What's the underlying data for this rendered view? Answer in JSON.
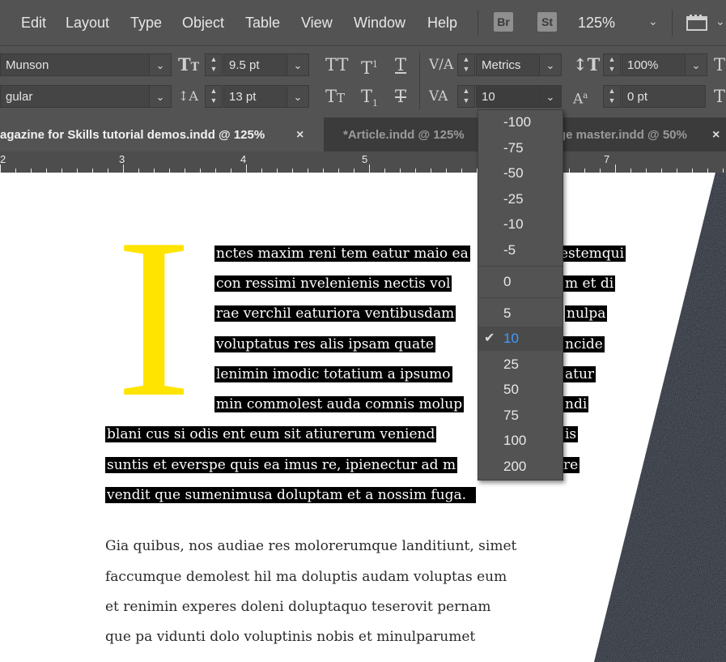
{
  "menu": {
    "items": [
      "Edit",
      "Layout",
      "Type",
      "Object",
      "Table",
      "View",
      "Window",
      "Help"
    ],
    "bridge_label": "Br",
    "stock_label": "St",
    "zoom": "125%"
  },
  "control_panel": {
    "font_family": "Munson",
    "font_style": "gular",
    "font_size": "9.5 pt",
    "leading": "13 pt",
    "kerning": "Metrics",
    "tracking": "10",
    "vertical_scale": "100%",
    "baseline_shift": "0 pt"
  },
  "tabs": [
    {
      "label": "agazine for Skills tutorial demos.indd @ 125%",
      "active": true,
      "close": "×"
    },
    {
      "label": "*Article.indd @ 125%",
      "active": false
    },
    {
      "label": "ge master.indd @ 50%",
      "active": false,
      "close": "×"
    }
  ],
  "ruler": {
    "labels": [
      "2",
      "3",
      "4",
      "5",
      "7"
    ]
  },
  "document": {
    "drop_cap": "I",
    "drop_cap_color": "#ffe400",
    "selected_lines": [
      "nctes maxim reni tem eatur maio ea",
      "estemqui",
      "con ressimi nvelenienis nectis vol",
      "m et di",
      "rae verchil eaturiora ventibusdam",
      "nulpa",
      "voluptatus res alis ipsam quate",
      "ncide",
      "lenimin imodic totatium a ipsumo",
      "atur",
      "min commolest auda comnis molup",
      "ndi",
      "blani cus si odis ent eum sit atiurerum veniend",
      "is",
      "suntis et everspe quis ea imus re, ipienectur ad m",
      "re",
      "vendit que sumenimusa doluptam et a nossim fuga."
    ],
    "body_lines": [
      "Gia quibus, nos audiae res molorerumque landitiunt, simet",
      "faccumque demolest hil ma doluptis audam voluptas eum",
      "et renimin experes doleni doluptaquo teserovit pernam",
      "que pa vidunti dolo voluptinis nobis et minulparumet"
    ]
  },
  "tracking_dropdown": {
    "options": [
      "-100",
      "-75",
      "-50",
      "-25",
      "-10",
      "-5",
      "0",
      "5",
      "10",
      "25",
      "50",
      "75",
      "100",
      "200"
    ],
    "selected": "10",
    "accent_color": "#3e9bff"
  },
  "icons": {
    "font_size": "font-size-icon",
    "leading": "leading-icon",
    "all_caps": "all-caps-icon",
    "superscript": "superscript-icon",
    "underline": "underline-icon",
    "small_caps": "small-caps-icon",
    "subscript": "subscript-icon",
    "strikethrough": "strikethrough-icon",
    "kerning": "kerning-icon",
    "tracking": "tracking-icon",
    "vertical_scale": "vertical-scale-icon",
    "baseline_shift": "baseline-shift-icon",
    "check": "checkmark-icon"
  }
}
